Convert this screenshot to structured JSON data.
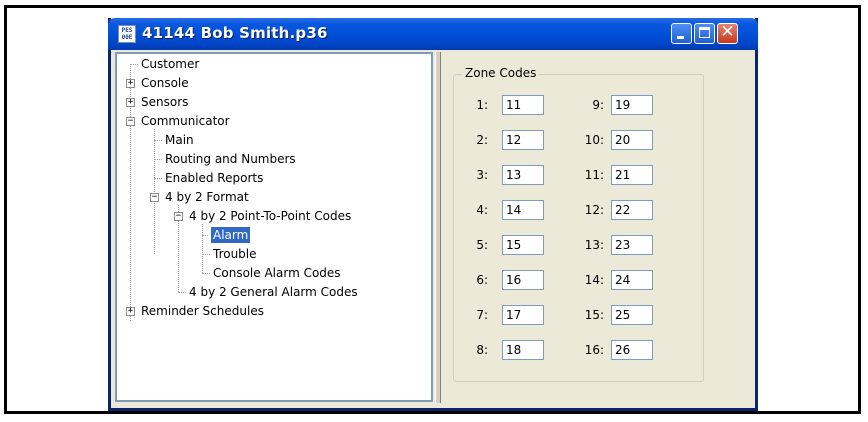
{
  "window": {
    "title": "41144 Bob Smith.p36",
    "icon_text": "PES\n00E"
  },
  "tree": [
    {
      "label": "Customer"
    },
    {
      "label": "Console"
    },
    {
      "label": "Sensors"
    },
    {
      "label": "Communicator"
    },
    {
      "label": "Main"
    },
    {
      "label": "Routing and Numbers"
    },
    {
      "label": "Enabled Reports"
    },
    {
      "label": "4 by 2 Format"
    },
    {
      "label": "4 by 2 Point-To-Point Codes"
    },
    {
      "label": "Alarm"
    },
    {
      "label": "Trouble"
    },
    {
      "label": "Console Alarm Codes"
    },
    {
      "label": "4 by 2 General Alarm Codes"
    },
    {
      "label": "Reminder Schedules"
    }
  ],
  "zone_codes": {
    "title": "Zone Codes",
    "left": [
      {
        "label": "1:",
        "value": "11"
      },
      {
        "label": "2:",
        "value": "12"
      },
      {
        "label": "3:",
        "value": "13"
      },
      {
        "label": "4:",
        "value": "14"
      },
      {
        "label": "5:",
        "value": "15"
      },
      {
        "label": "6:",
        "value": "16"
      },
      {
        "label": "7:",
        "value": "17"
      },
      {
        "label": "8:",
        "value": "18"
      }
    ],
    "right": [
      {
        "label": "9:",
        "value": "19"
      },
      {
        "label": "10:",
        "value": "20"
      },
      {
        "label": "11:",
        "value": "21"
      },
      {
        "label": "12:",
        "value": "22"
      },
      {
        "label": "13:",
        "value": "23"
      },
      {
        "label": "14:",
        "value": "24"
      },
      {
        "label": "15:",
        "value": "25"
      },
      {
        "label": "16:",
        "value": "26"
      }
    ]
  }
}
